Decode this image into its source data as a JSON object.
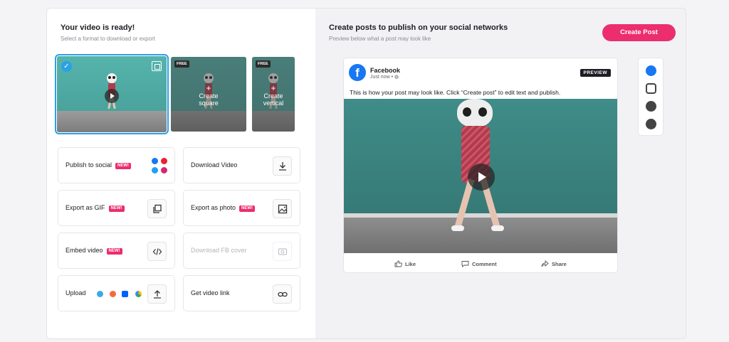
{
  "left": {
    "title": "Your video is ready!",
    "subtitle": "Select a format to download or export",
    "formats": [
      {
        "name": "original",
        "selected": true
      },
      {
        "name": "square",
        "badge": "FREE",
        "label_line1": "Create",
        "label_line2": "square"
      },
      {
        "name": "vertical",
        "badge": "FREE",
        "label_line1": "Create",
        "label_line2": "vertical"
      }
    ],
    "actions": {
      "publish": {
        "label": "Publish to social",
        "badge": "NEW!"
      },
      "download": {
        "label": "Download Video"
      },
      "gif": {
        "label": "Export as GIF",
        "badge": "NEW!"
      },
      "photo": {
        "label": "Export as photo",
        "badge": "NEW!"
      },
      "embed": {
        "label": "Embed video",
        "badge": "NEW!"
      },
      "fb_cover": {
        "label": "Download FB cover"
      },
      "upload": {
        "label": "Upload"
      },
      "link": {
        "label": "Get video link"
      }
    }
  },
  "right": {
    "title": "Create posts to publish on your social networks",
    "subtitle": "Preview below what a post may look like",
    "create_button": "Create Post",
    "post": {
      "page_name": "Facebook",
      "time": "Just now",
      "preview_badge": "PREVIEW",
      "text": "This is how your post may look like. Click “Create post” to edit text and publish.",
      "like": "Like",
      "comment": "Comment",
      "share": "Share"
    },
    "networks": [
      "facebook-icon",
      "instagram-icon",
      "youtube-icon",
      "twitter-icon"
    ]
  },
  "colors": {
    "accent": "#ec2d6e",
    "selection": "#2aa1e6",
    "facebook": "#1877f2"
  }
}
